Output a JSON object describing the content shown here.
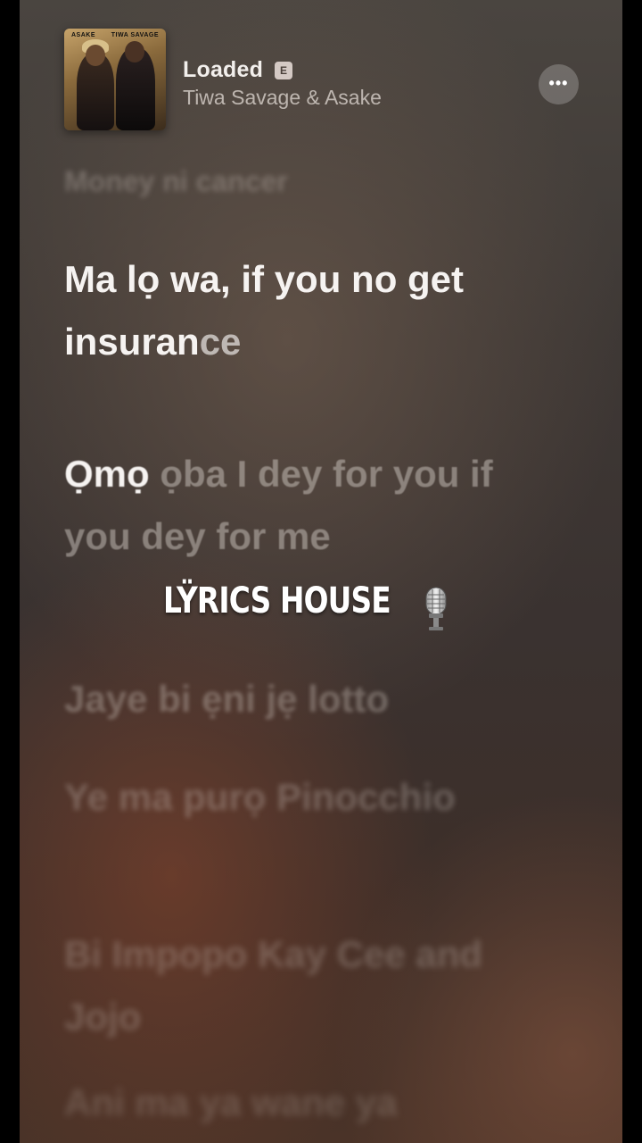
{
  "now_playing": {
    "title": "Loaded",
    "explicit_badge": "E",
    "artist": "Tiwa Savage & Asake",
    "more_button_label": "•••",
    "album_art": {
      "left_text": "ASAKE",
      "right_text": "TIWA SAVAGE"
    }
  },
  "lyrics": {
    "previous_line": "Money ni cancer",
    "active_line": {
      "sung_part": "Ma lọ wa, if you no get insuran",
      "remaining_part": "ce"
    },
    "next_line": {
      "highlighted_part": "Ọmọ",
      "rest": " ọba I dey for you if you dey for me"
    },
    "upcoming_lines": [
      "Jaye bi ẹni jẹ lotto",
      "Ye ma purọ Pinocchio",
      "Bi Impopo Kay Cee and Jojo",
      "Ani ma ya wane ya"
    ]
  },
  "watermark": {
    "text": "LŸRICS HOUSE",
    "icon": "microphone-icon"
  }
}
